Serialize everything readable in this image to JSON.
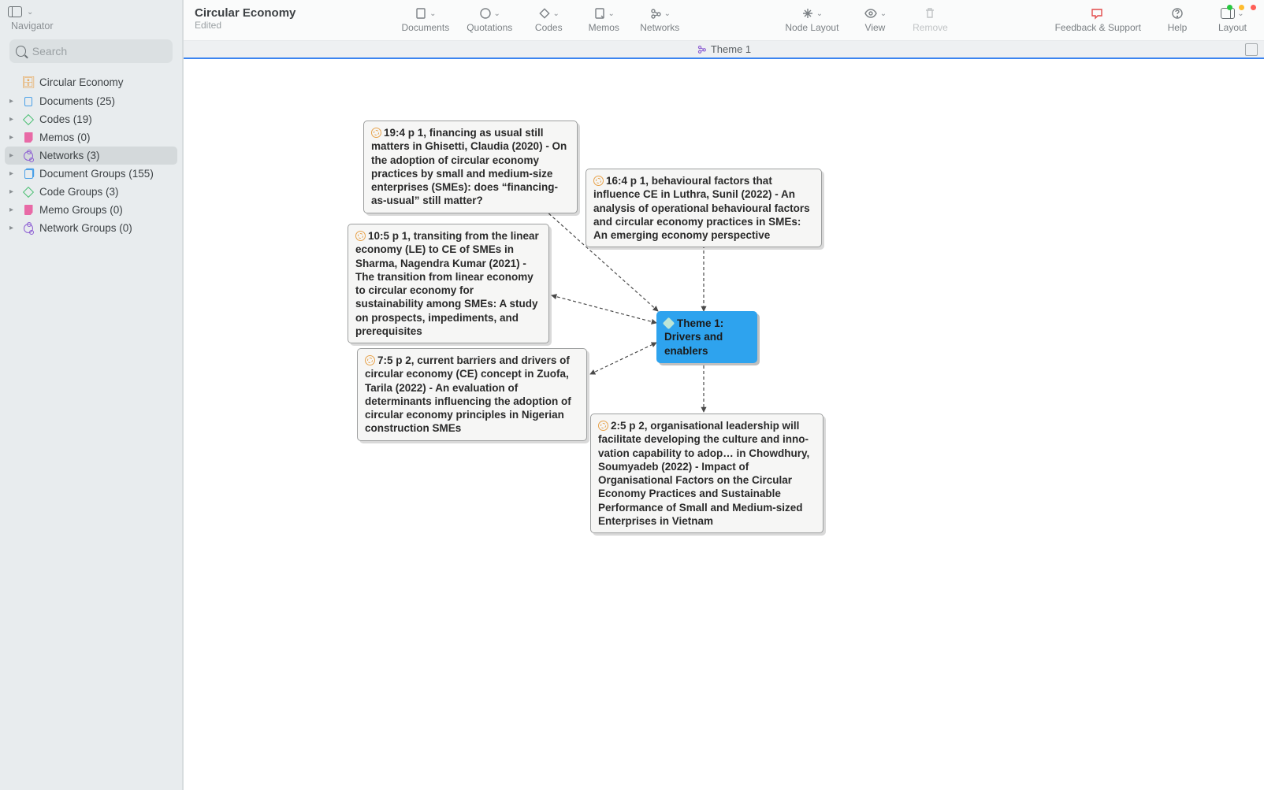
{
  "window": {
    "title": "Circular Economy",
    "subtitle": "Edited"
  },
  "sidebar": {
    "title": "Navigator",
    "search_placeholder": "Search",
    "items": [
      {
        "label": "Circular Economy",
        "type": "case",
        "expandable": false,
        "selected": false
      },
      {
        "label": "Documents (25)",
        "type": "doc",
        "expandable": true
      },
      {
        "label": "Codes (19)",
        "type": "code",
        "expandable": true
      },
      {
        "label": "Memos (0)",
        "type": "memo",
        "expandable": true
      },
      {
        "label": "Networks (3)",
        "type": "net",
        "expandable": true,
        "selected": true
      },
      {
        "label": "Document Groups (155)",
        "type": "dgrp",
        "expandable": true
      },
      {
        "label": "Code Groups (3)",
        "type": "code",
        "expandable": true
      },
      {
        "label": "Memo Groups (0)",
        "type": "memo",
        "expandable": true
      },
      {
        "label": "Network Groups (0)",
        "type": "net",
        "expandable": true
      }
    ]
  },
  "toolbar": {
    "documents": "Documents",
    "quotations": "Quotations",
    "codes": "Codes",
    "memos": "Memos",
    "networks": "Networks",
    "node_layout": "Node Layout",
    "view": "View",
    "remove": "Remove",
    "feedback": "Feedback & Support",
    "help": "Help",
    "layout": "Layout"
  },
  "tab": {
    "label": "Theme 1"
  },
  "network": {
    "center": "Theme 1: Drivers and enablers",
    "nodes": [
      "19:4 p 1, financing as usual still matters in Ghisetti, Claudia (2020) - On the adoption of circular economy practices by small and medium-size enterprises (SMEs): does “financing-as-usual” still matter?",
      "16:4 p 1, behavioural factors that influence CE in Luthra, Sunil (2022) - An analysis of operational behavioural factors and circular economy practices in SMEs: An emerging economy perspective",
      "10:5 p 1, transiting from the linear economy (LE) to CE of SMEs in Sharma, Nagendra Kumar (2021) - The transition from linear economy to circular economy for sustainability among SMEs: A study on prospects, impediments, and prerequisites",
      "7:5 p 2, current barriers and drivers of circular economy (CE) concept in Zuofa, Tarila (2022) - An evaluation of determinants influencing the adoption of circular economy principles in Nigerian construction SMEs",
      "2:5 p 2, organisational leadership will facilitate developing the culture and inno-vation capability to adop… in Chowdhury, Soumyadeb (2022) - Impact of Organisational Factors on the Circular Economy Practices and Sustainable Performance of Small and Medium-sized Enterprises in Vietnam"
    ]
  }
}
